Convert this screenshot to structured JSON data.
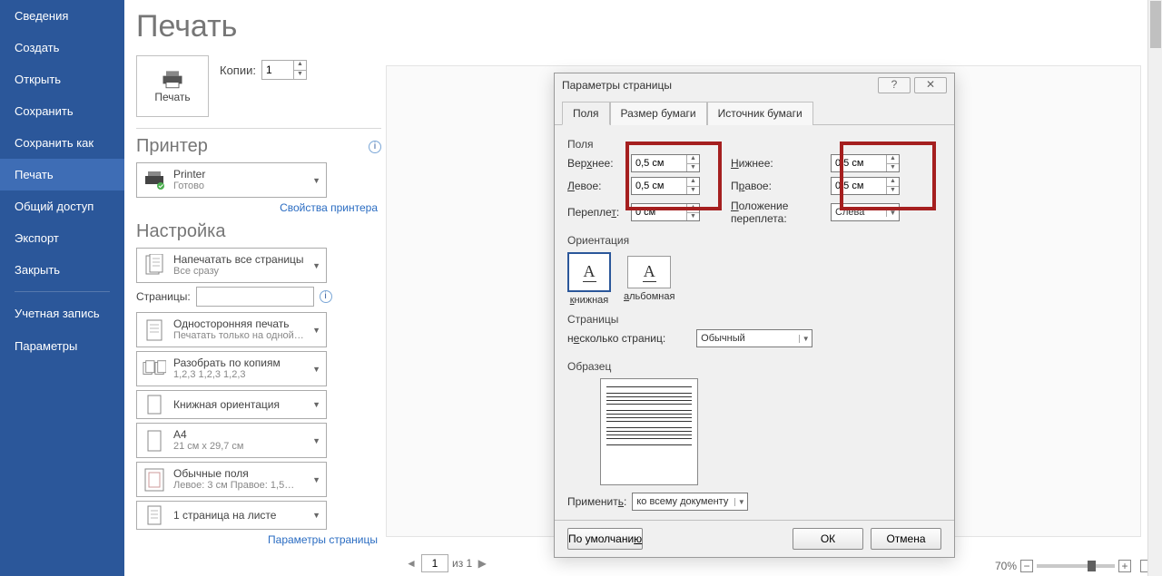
{
  "title": "Печать",
  "sidebar": {
    "items": [
      {
        "label": "Сведения"
      },
      {
        "label": "Создать"
      },
      {
        "label": "Открыть"
      },
      {
        "label": "Сохранить"
      },
      {
        "label": "Сохранить как"
      },
      {
        "label": "Печать"
      },
      {
        "label": "Общий доступ"
      },
      {
        "label": "Экспорт"
      },
      {
        "label": "Закрыть"
      }
    ],
    "account": "Учетная запись",
    "options": "Параметры"
  },
  "print_button": "Печать",
  "copies_label": "Копии:",
  "copies_value": "1",
  "printer_section": "Принтер",
  "printer": {
    "name": "Printer",
    "status": "Готово"
  },
  "printer_props": "Свойства принтера",
  "setup_section": "Настройка",
  "opt_all": {
    "l1": "Напечатать все страницы",
    "l2": "Все сразу"
  },
  "pages_label": "Страницы:",
  "opt_side": {
    "l1": "Односторонняя печать",
    "l2": "Печатать только на одной…"
  },
  "opt_collate": {
    "l1": "Разобрать по копиям",
    "l2": "1,2,3   1,2,3   1,2,3"
  },
  "opt_orient": {
    "l1": "Книжная ориентация"
  },
  "opt_paper": {
    "l1": "A4",
    "l2": "21 см x 29,7 см"
  },
  "opt_margins": {
    "l1": "Обычные поля",
    "l2": "Левое: 3 см   Правое: 1,5…"
  },
  "opt_ppp": {
    "l1": "1 страница на листе"
  },
  "page_params": "Параметры страницы",
  "dialog": {
    "title": "Параметры страницы",
    "tabs": [
      "Поля",
      "Размер бумаги",
      "Источник бумаги"
    ],
    "fields_group": "Поля",
    "top": "Вер<u>х</u>нее:",
    "top_v": "0,5 см",
    "bottom": "<u>Н</u>ижнее:",
    "bottom_v": "0,5 см",
    "left": "<u>Л</u>евое:",
    "left_v": "0,5 см",
    "right": "П<u>р</u>авое:",
    "right_v": "0,5 см",
    "gutter": "Перепле<u>т</u>:",
    "gutter_v": "0 см",
    "gutter_pos": "<u>П</u>оложение переплета:",
    "gutter_pos_v": "Слева",
    "orient": "Ориентация",
    "portrait": "<u>к</u>нижная",
    "landscape": "<u>а</u>льбомная",
    "pages": "Страницы",
    "multi": "н<u>е</u>сколько страниц:",
    "multi_v": "Обычный",
    "sample": "Образец",
    "apply": "Применит<u>ь</u>:",
    "apply_v": "ко всему документу",
    "default": "По умолчани<u>ю</u>",
    "ok": "ОК",
    "cancel": "Отмена"
  },
  "nav": {
    "prev": "◄",
    "page": "1",
    "of": "из 1",
    "next": "▶"
  },
  "zoom": {
    "value": "70%"
  }
}
